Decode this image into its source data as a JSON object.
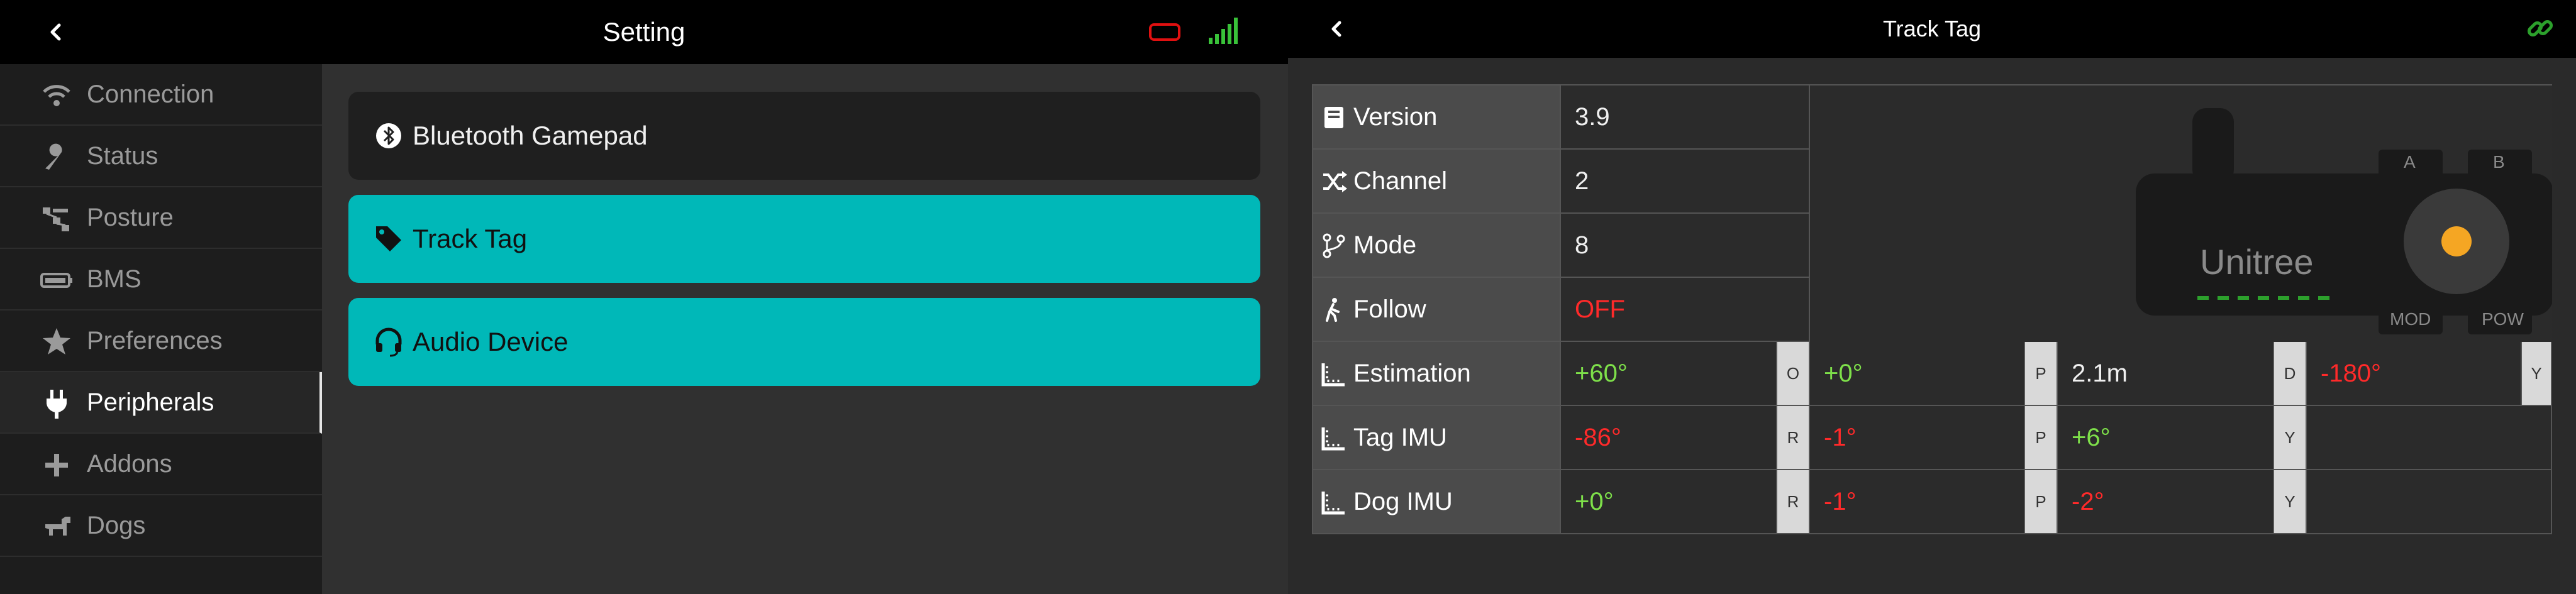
{
  "left": {
    "title": "Setting",
    "sidebar": {
      "items": [
        {
          "label": "Connection",
          "icon": "wifi-icon",
          "active": false
        },
        {
          "label": "Status",
          "icon": "wrench-icon",
          "active": false
        },
        {
          "label": "Posture",
          "icon": "posture-icon",
          "active": false
        },
        {
          "label": "BMS",
          "icon": "battery-icon",
          "active": false
        },
        {
          "label": "Preferences",
          "icon": "star-icon",
          "active": false
        },
        {
          "label": "Peripherals",
          "icon": "plug-icon",
          "active": true
        },
        {
          "label": "Addons",
          "icon": "plus-icon",
          "active": false
        },
        {
          "label": "Dogs",
          "icon": "dog-icon",
          "active": false
        }
      ]
    },
    "cards": [
      {
        "label": "Bluetooth Gamepad",
        "icon": "bluetooth-icon",
        "style": "dark"
      },
      {
        "label": "Track Tag",
        "icon": "tag-icon",
        "style": "teal"
      },
      {
        "label": "Audio Device",
        "icon": "headset-icon",
        "style": "teal"
      }
    ],
    "status": {
      "battery_color": "#e01010",
      "signal_color": "#39c239"
    }
  },
  "right": {
    "title": "Track Tag",
    "link_color": "#2ca02c",
    "rows": [
      {
        "label": "Version",
        "icon": "book-icon",
        "value": "3.9"
      },
      {
        "label": "Channel",
        "icon": "shuffle-icon",
        "value": "2"
      },
      {
        "label": "Mode",
        "icon": "fork-icon",
        "value": "8"
      },
      {
        "label": "Follow",
        "icon": "walk-icon",
        "value": "OFF"
      }
    ],
    "estimation": {
      "label": "Estimation",
      "v1": "+60°",
      "t1": "O",
      "v2": "+0°",
      "t2": "P",
      "v3": "2.1m",
      "t3": "D",
      "v4": "-180°",
      "t4": "Y"
    },
    "tag_imu": {
      "label": "Tag IMU",
      "v1": "-86°",
      "t1": "R",
      "v2": "-1°",
      "t2": "P",
      "v3": "+6°",
      "t3": "Y"
    },
    "dog_imu": {
      "label": "Dog IMU",
      "v1": "+0°",
      "t1": "R",
      "v2": "-1°",
      "t2": "P",
      "v3": "-2°",
      "t3": "Y"
    },
    "device": {
      "brand": "Unitree",
      "btn_a": "A",
      "btn_b": "B",
      "mod": "MOD",
      "pow": "POW",
      "led_color": "#f5a623"
    }
  }
}
